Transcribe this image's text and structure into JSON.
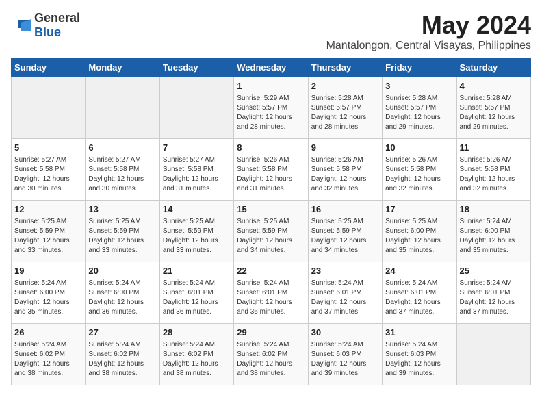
{
  "logo": {
    "text_general": "General",
    "text_blue": "Blue"
  },
  "title": "May 2024",
  "location": "Mantalongon, Central Visayas, Philippines",
  "days_of_week": [
    "Sunday",
    "Monday",
    "Tuesday",
    "Wednesday",
    "Thursday",
    "Friday",
    "Saturday"
  ],
  "weeks": [
    [
      {
        "day": "",
        "sunrise": "",
        "sunset": "",
        "daylight": ""
      },
      {
        "day": "",
        "sunrise": "",
        "sunset": "",
        "daylight": ""
      },
      {
        "day": "",
        "sunrise": "",
        "sunset": "",
        "daylight": ""
      },
      {
        "day": "1",
        "sunrise": "Sunrise: 5:29 AM",
        "sunset": "Sunset: 5:57 PM",
        "daylight": "Daylight: 12 hours and 28 minutes."
      },
      {
        "day": "2",
        "sunrise": "Sunrise: 5:28 AM",
        "sunset": "Sunset: 5:57 PM",
        "daylight": "Daylight: 12 hours and 28 minutes."
      },
      {
        "day": "3",
        "sunrise": "Sunrise: 5:28 AM",
        "sunset": "Sunset: 5:57 PM",
        "daylight": "Daylight: 12 hours and 29 minutes."
      },
      {
        "day": "4",
        "sunrise": "Sunrise: 5:28 AM",
        "sunset": "Sunset: 5:57 PM",
        "daylight": "Daylight: 12 hours and 29 minutes."
      }
    ],
    [
      {
        "day": "5",
        "sunrise": "Sunrise: 5:27 AM",
        "sunset": "Sunset: 5:58 PM",
        "daylight": "Daylight: 12 hours and 30 minutes."
      },
      {
        "day": "6",
        "sunrise": "Sunrise: 5:27 AM",
        "sunset": "Sunset: 5:58 PM",
        "daylight": "Daylight: 12 hours and 30 minutes."
      },
      {
        "day": "7",
        "sunrise": "Sunrise: 5:27 AM",
        "sunset": "Sunset: 5:58 PM",
        "daylight": "Daylight: 12 hours and 31 minutes."
      },
      {
        "day": "8",
        "sunrise": "Sunrise: 5:26 AM",
        "sunset": "Sunset: 5:58 PM",
        "daylight": "Daylight: 12 hours and 31 minutes."
      },
      {
        "day": "9",
        "sunrise": "Sunrise: 5:26 AM",
        "sunset": "Sunset: 5:58 PM",
        "daylight": "Daylight: 12 hours and 32 minutes."
      },
      {
        "day": "10",
        "sunrise": "Sunrise: 5:26 AM",
        "sunset": "Sunset: 5:58 PM",
        "daylight": "Daylight: 12 hours and 32 minutes."
      },
      {
        "day": "11",
        "sunrise": "Sunrise: 5:26 AM",
        "sunset": "Sunset: 5:58 PM",
        "daylight": "Daylight: 12 hours and 32 minutes."
      }
    ],
    [
      {
        "day": "12",
        "sunrise": "Sunrise: 5:25 AM",
        "sunset": "Sunset: 5:59 PM",
        "daylight": "Daylight: 12 hours and 33 minutes."
      },
      {
        "day": "13",
        "sunrise": "Sunrise: 5:25 AM",
        "sunset": "Sunset: 5:59 PM",
        "daylight": "Daylight: 12 hours and 33 minutes."
      },
      {
        "day": "14",
        "sunrise": "Sunrise: 5:25 AM",
        "sunset": "Sunset: 5:59 PM",
        "daylight": "Daylight: 12 hours and 33 minutes."
      },
      {
        "day": "15",
        "sunrise": "Sunrise: 5:25 AM",
        "sunset": "Sunset: 5:59 PM",
        "daylight": "Daylight: 12 hours and 34 minutes."
      },
      {
        "day": "16",
        "sunrise": "Sunrise: 5:25 AM",
        "sunset": "Sunset: 5:59 PM",
        "daylight": "Daylight: 12 hours and 34 minutes."
      },
      {
        "day": "17",
        "sunrise": "Sunrise: 5:25 AM",
        "sunset": "Sunset: 6:00 PM",
        "daylight": "Daylight: 12 hours and 35 minutes."
      },
      {
        "day": "18",
        "sunrise": "Sunrise: 5:24 AM",
        "sunset": "Sunset: 6:00 PM",
        "daylight": "Daylight: 12 hours and 35 minutes."
      }
    ],
    [
      {
        "day": "19",
        "sunrise": "Sunrise: 5:24 AM",
        "sunset": "Sunset: 6:00 PM",
        "daylight": "Daylight: 12 hours and 35 minutes."
      },
      {
        "day": "20",
        "sunrise": "Sunrise: 5:24 AM",
        "sunset": "Sunset: 6:00 PM",
        "daylight": "Daylight: 12 hours and 36 minutes."
      },
      {
        "day": "21",
        "sunrise": "Sunrise: 5:24 AM",
        "sunset": "Sunset: 6:01 PM",
        "daylight": "Daylight: 12 hours and 36 minutes."
      },
      {
        "day": "22",
        "sunrise": "Sunrise: 5:24 AM",
        "sunset": "Sunset: 6:01 PM",
        "daylight": "Daylight: 12 hours and 36 minutes."
      },
      {
        "day": "23",
        "sunrise": "Sunrise: 5:24 AM",
        "sunset": "Sunset: 6:01 PM",
        "daylight": "Daylight: 12 hours and 37 minutes."
      },
      {
        "day": "24",
        "sunrise": "Sunrise: 5:24 AM",
        "sunset": "Sunset: 6:01 PM",
        "daylight": "Daylight: 12 hours and 37 minutes."
      },
      {
        "day": "25",
        "sunrise": "Sunrise: 5:24 AM",
        "sunset": "Sunset: 6:01 PM",
        "daylight": "Daylight: 12 hours and 37 minutes."
      }
    ],
    [
      {
        "day": "26",
        "sunrise": "Sunrise: 5:24 AM",
        "sunset": "Sunset: 6:02 PM",
        "daylight": "Daylight: 12 hours and 38 minutes."
      },
      {
        "day": "27",
        "sunrise": "Sunrise: 5:24 AM",
        "sunset": "Sunset: 6:02 PM",
        "daylight": "Daylight: 12 hours and 38 minutes."
      },
      {
        "day": "28",
        "sunrise": "Sunrise: 5:24 AM",
        "sunset": "Sunset: 6:02 PM",
        "daylight": "Daylight: 12 hours and 38 minutes."
      },
      {
        "day": "29",
        "sunrise": "Sunrise: 5:24 AM",
        "sunset": "Sunset: 6:02 PM",
        "daylight": "Daylight: 12 hours and 38 minutes."
      },
      {
        "day": "30",
        "sunrise": "Sunrise: 5:24 AM",
        "sunset": "Sunset: 6:03 PM",
        "daylight": "Daylight: 12 hours and 39 minutes."
      },
      {
        "day": "31",
        "sunrise": "Sunrise: 5:24 AM",
        "sunset": "Sunset: 6:03 PM",
        "daylight": "Daylight: 12 hours and 39 minutes."
      },
      {
        "day": "",
        "sunrise": "",
        "sunset": "",
        "daylight": ""
      }
    ]
  ]
}
